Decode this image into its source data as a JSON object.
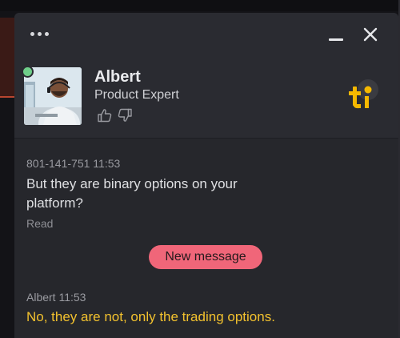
{
  "chat": {
    "agent": {
      "name": "Albert",
      "role": "Product Expert",
      "online": true
    },
    "header_icons": {
      "menu": "more-dots-icon",
      "minimize": "minimize-icon",
      "close": "close-icon",
      "like": "thumbs-up-icon",
      "dislike": "thumbs-down-icon",
      "brand": "ti-logo"
    },
    "messages": [
      {
        "sender": "801-141-751",
        "time": "11:53",
        "meta": "801-141-751 11:53",
        "text_line1": "But they are binary options on your",
        "text_line2": "platform?",
        "status": "Read"
      },
      {
        "sender": "Albert",
        "time": "11:53",
        "meta": "Albert 11:53",
        "text": "No, they are not, only the trading options."
      }
    ],
    "new_message_label": "New message"
  },
  "colors": {
    "widget_bg": "#26272c",
    "header_bg": "#2a2b31",
    "new_message_pill": "#f06679",
    "agent_text": "#f2c12e",
    "online": "#6fcf8a",
    "brand_yellow": "#f5b800"
  }
}
